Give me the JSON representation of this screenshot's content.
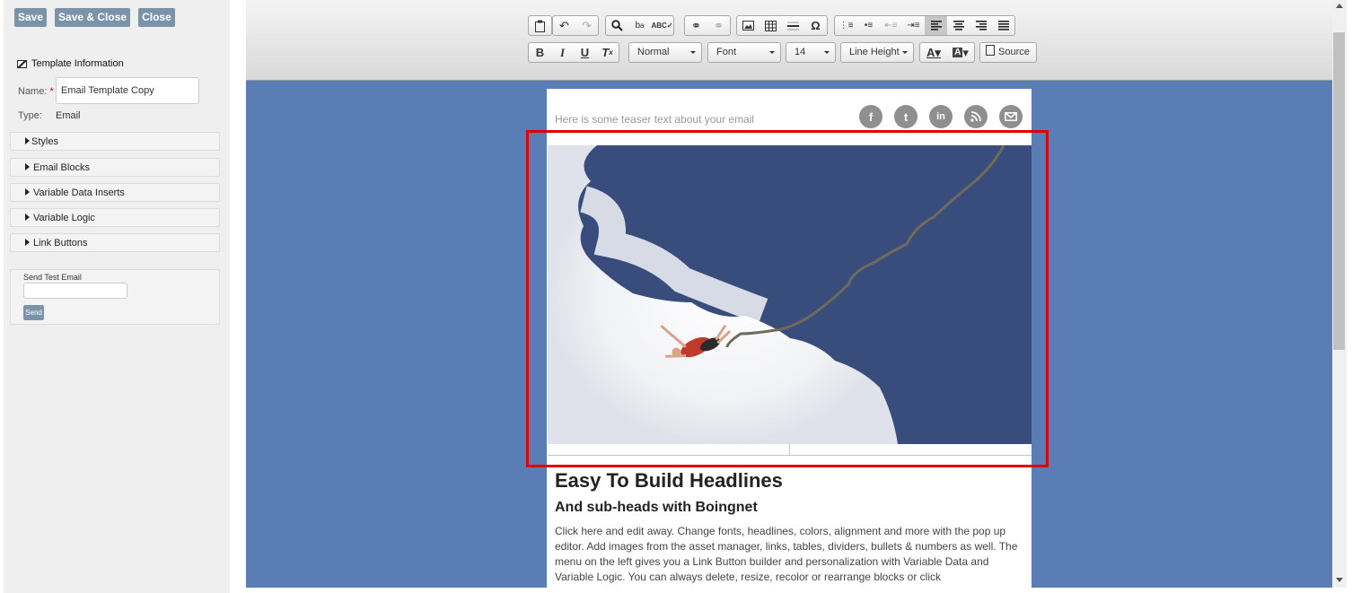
{
  "sidebar": {
    "buttons": {
      "save": "Save",
      "save_close": "Save & Close",
      "close": "Close"
    },
    "template_info": {
      "title": "Template Information",
      "name_label": "Name:",
      "required_mark": "*",
      "name_value": "Email Template Copy",
      "type_label": "Type:",
      "type_value": "Email"
    },
    "accordions": [
      "Styles",
      "Email Blocks",
      "Variable Data Inserts",
      "Variable Logic",
      "Link Buttons"
    ],
    "test_email": {
      "label": "Send Test Email",
      "send": "Send"
    }
  },
  "toolbar": {
    "format": "Normal",
    "font": "Font",
    "size": "14",
    "line_height": "Line Height",
    "source": "Source"
  },
  "email": {
    "teaser": "Here is some teaser text about your email",
    "social": [
      "f",
      "t",
      "in",
      "rss",
      "mail"
    ],
    "headline": "Easy To Build Headlines",
    "subhead": "And sub-heads with Boingnet",
    "body": "Click here and edit away. Change fonts, headlines, colors, alignment and more with the pop up editor. Add images from the asset manager, links, tables, dividers, bullets & numbers as well. The menu on the left gives you a Link Button builder and personalization with Variable Data and Variable Logic. You can always delete, resize, recolor or rearrange blocks or click"
  },
  "colors": {
    "canvas": "#5b7db6",
    "button": "#7b93a9",
    "highlight": "#e10000"
  }
}
